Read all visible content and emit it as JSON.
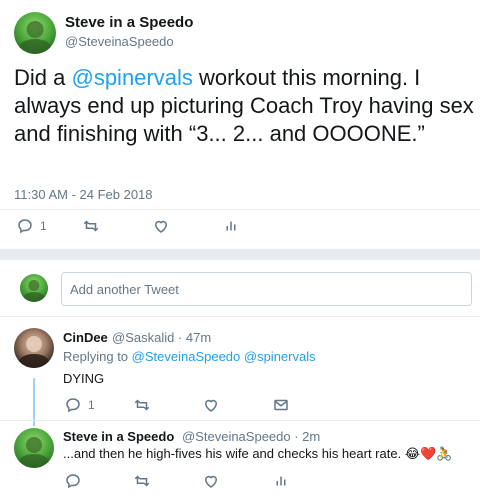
{
  "tweet": {
    "author_name": "Steve in a Speedo",
    "author_handle": "@SteveinaSpeedo",
    "text_before": "Did a ",
    "mention": "@spinervals",
    "text_after": " workout this morning. I always end up picturing Coach Troy having sex and finishing with “3... 2... and OOOONE.”",
    "timestamp": "11:30 AM - 24 Feb 2018",
    "reply_count": "1"
  },
  "compose": {
    "placeholder": "Add another Tweet"
  },
  "replies": [
    {
      "author_name": "CinDee",
      "author_handle": "@Saskalid",
      "age": "· 47m",
      "replying_prefix": "Replying to ",
      "replying_mentions": "@SteveinaSpeedo @spinervals",
      "text": "DYING",
      "reply_count": "1"
    },
    {
      "author_name": "Steve in a Speedo",
      "author_handle": "@SteveinaSpeedo",
      "age": "· 2m",
      "text": "...and then he high-fives his wife and checks his heart rate.",
      "emojis": "😂❤️🚴"
    }
  ],
  "colors": {
    "accent": "#1da1f2",
    "muted": "#657786",
    "text": "#14171a",
    "divider": "#e6ecf0"
  }
}
